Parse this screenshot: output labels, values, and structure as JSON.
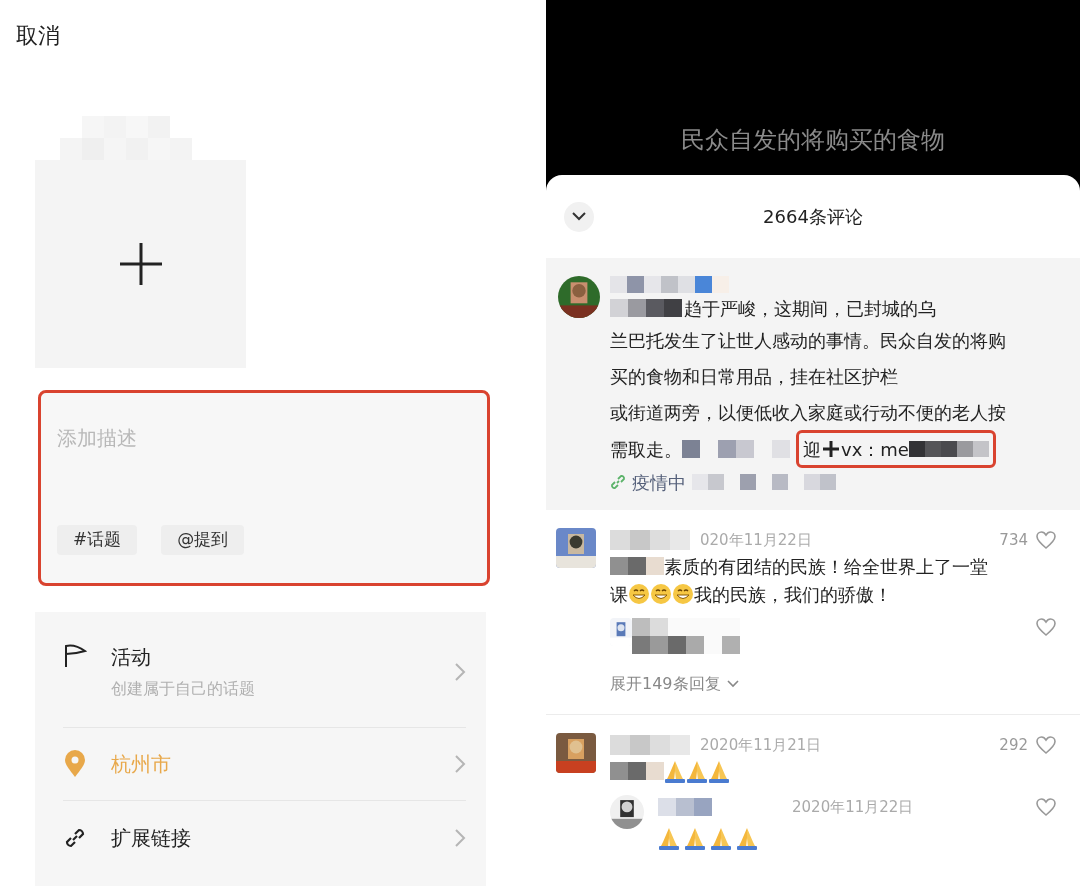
{
  "left": {
    "cancel": "取消",
    "placeholder": "添加描述",
    "chips": [
      "#话题",
      "@提到"
    ],
    "options": [
      {
        "kind": "activity",
        "title": "活动",
        "subtitle": "创建属于自己的话题",
        "highlighted": false
      },
      {
        "kind": "location",
        "title": "杭州市",
        "highlighted": true
      },
      {
        "kind": "link",
        "title": "扩展链接",
        "highlighted": false
      }
    ]
  },
  "video": {
    "caption": "民众自发的将购买的食物"
  },
  "sheet": {
    "title": "2664条评论",
    "pinned": {
      "lines": [
        "趋于严峻，这期间，已封城的乌",
        "兰巴托发生了让世人感动的事情。民众自发的将购",
        "买的食物和日常用品，挂在社区护栏",
        "或街道两旁，以便低收入家庭或行动不便的老人按"
      ],
      "last": "需取走。",
      "contact_lead": "迎",
      "contact": "vx：me",
      "link": "疫情中"
    },
    "comments": [
      {
        "date": "020年11月22日",
        "likes": "734",
        "lines": [
          [
            {
              "kind": "text",
              "text": "素质的有团结的民族！给全世界上了一堂"
            }
          ],
          [
            {
              "kind": "text",
              "text": "课"
            },
            {
              "kind": "grin"
            },
            {
              "kind": "grin"
            },
            {
              "kind": "grin"
            },
            {
              "kind": "text",
              "text": "我的民族，我们的骄傲！"
            }
          ]
        ],
        "reply": {
          "kind": "blurred"
        },
        "expand": "展开149条回复"
      },
      {
        "date": "2020年11月21日",
        "likes": "292",
        "lines": [
          [
            {
              "kind": "pray"
            },
            {
              "kind": "pray"
            },
            {
              "kind": "pray"
            }
          ]
        ],
        "reply": {
          "kind": "dated",
          "date": "2020年11月22日",
          "lines": [
            [
              {
                "kind": "pray"
              },
              {
                "kind": "pray"
              },
              {
                "kind": "pray"
              },
              {
                "kind": "pray"
              }
            ]
          ]
        }
      }
    ]
  }
}
